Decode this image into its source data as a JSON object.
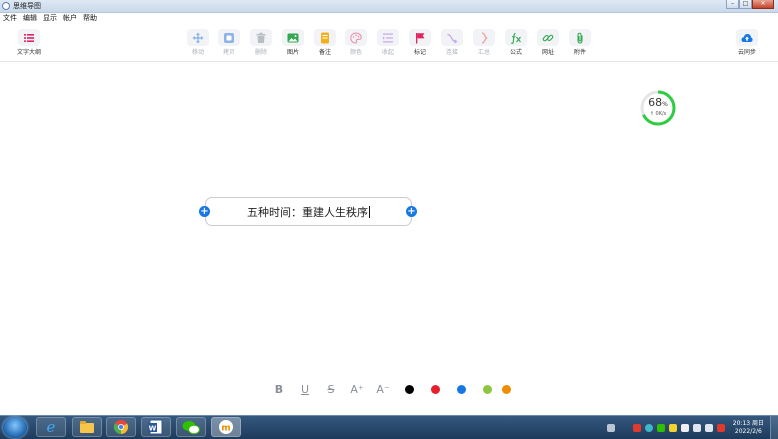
{
  "window": {
    "title": "思维导图"
  },
  "window_buttons": {
    "minimize": "–",
    "maximize": "□",
    "close": "✕"
  },
  "menu": [
    "文件",
    "编辑",
    "显示",
    "帐户",
    "帮助"
  ],
  "toolbar": {
    "outline": {
      "label": "文字大纲",
      "icon": "outline-icon"
    },
    "tools": [
      {
        "label": "移动",
        "icon": "move-icon",
        "enabled": false,
        "color": "#8fb3e8"
      },
      {
        "label": "拷贝",
        "icon": "copy-icon",
        "enabled": false,
        "color": "#8fb3e8"
      },
      {
        "label": "删除",
        "icon": "trash-icon",
        "enabled": false,
        "color": "#b9bec6"
      },
      {
        "label": "图片",
        "icon": "image-icon",
        "enabled": true,
        "color": "#2fa84f"
      },
      {
        "label": "备注",
        "icon": "note-icon",
        "enabled": true,
        "color": "#f2b01e"
      },
      {
        "label": "颜色",
        "icon": "palette-icon",
        "enabled": false,
        "color": "#e98aa7"
      },
      {
        "label": "收起",
        "icon": "collapse-icon",
        "enabled": false,
        "color": "#c9a6e8"
      },
      {
        "label": "标记",
        "icon": "flag-icon",
        "enabled": true,
        "color": "#e0245e"
      },
      {
        "label": "连接",
        "icon": "connect-icon",
        "enabled": false,
        "color": "#c9a6e8"
      },
      {
        "label": "汇总",
        "icon": "summary-icon",
        "enabled": false,
        "color": "#f0a0a0"
      },
      {
        "label": "公式",
        "icon": "formula-icon",
        "enabled": true,
        "color": "#2fa84f"
      },
      {
        "label": "网址",
        "icon": "link-icon",
        "enabled": true,
        "color": "#2fa84f"
      },
      {
        "label": "附件",
        "icon": "attachment-icon",
        "enabled": true,
        "color": "#2fa84f"
      }
    ],
    "sync": {
      "label": "云同步",
      "icon": "cloud-upload-icon"
    }
  },
  "node": {
    "text": "五种时间：重建人生秩序"
  },
  "speed_widget": {
    "percent": 68,
    "percent_unit": "%",
    "net": "↑ 0K/s",
    "ring_color": "#2ecc40"
  },
  "format_bar": {
    "bold": "B",
    "underline": "U",
    "strike": "S",
    "font_bigger": "A⁺",
    "font_smaller": "A⁻",
    "colors": [
      "#000000",
      "#e8202a",
      "#1677e6",
      "#8cc63f",
      "#f08c00"
    ]
  },
  "taskbar": {
    "clock_time": "20:13 周日",
    "clock_date": "2022/2/6",
    "apps": [
      "ie-icon",
      "explorer-icon",
      "chrome-icon",
      "word-icon",
      "wechat-icon",
      "mindmap-icon"
    ]
  }
}
